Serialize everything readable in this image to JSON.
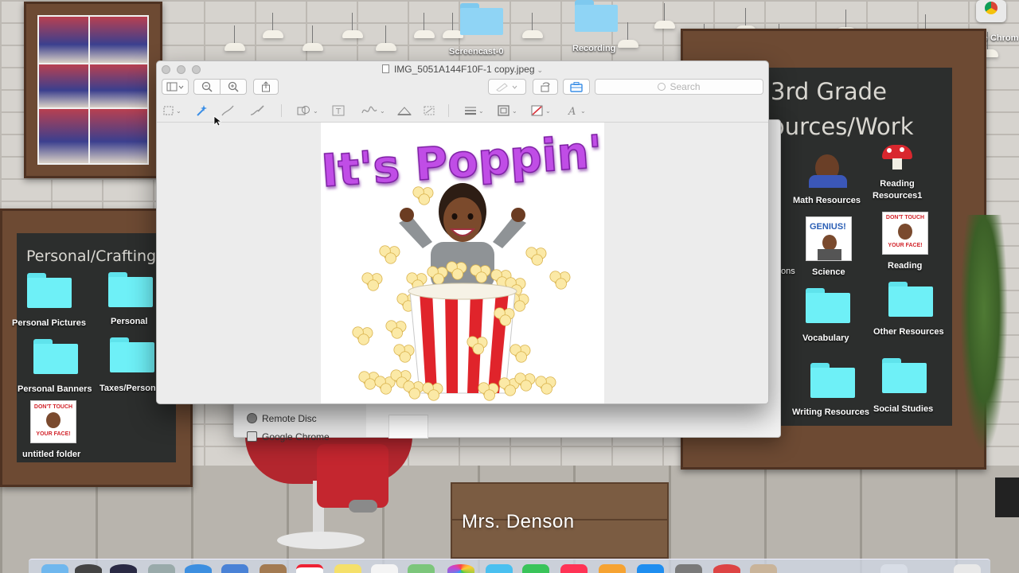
{
  "desktop": {
    "top_items": [
      {
        "label": "Screencast-0"
      },
      {
        "label": "Recording"
      },
      {
        "label": "Google Chrom"
      }
    ],
    "left_board": {
      "title": "Personal/Crafting",
      "items": [
        {
          "label": "Personal Pictures"
        },
        {
          "label": "Personal"
        },
        {
          "label": "Personal Banners"
        },
        {
          "label": "Taxes/Person"
        },
        {
          "label": "untitled folder"
        }
      ]
    },
    "right_board": {
      "title_line1": "3rd Grade",
      "title_line2": "ources/Work",
      "partial_label": "ons",
      "items": [
        {
          "label": "Math Resources"
        },
        {
          "label": "Reading Resources1"
        },
        {
          "label": "Science"
        },
        {
          "label": "Reading"
        },
        {
          "label": "Vocabulary"
        },
        {
          "label": "Other Resources"
        },
        {
          "label": "Writing Resources"
        },
        {
          "label": "Social Studies"
        }
      ]
    },
    "teacher_name": "Mrs. Denson",
    "sticker_text": [
      "DON'T TOUCH",
      "YOUR FACE!"
    ],
    "genius_text": "GENIUS!"
  },
  "finder_back": {
    "sidebar_items": [
      {
        "label": "Remote Disc"
      },
      {
        "label": "Google Chrome"
      }
    ]
  },
  "preview_window": {
    "title": "IMG_5051A144F10F-1 copy.jpeg",
    "search_placeholder": "Search",
    "image_text": "It's Poppin'",
    "accent_color": "#3a8ee6"
  }
}
